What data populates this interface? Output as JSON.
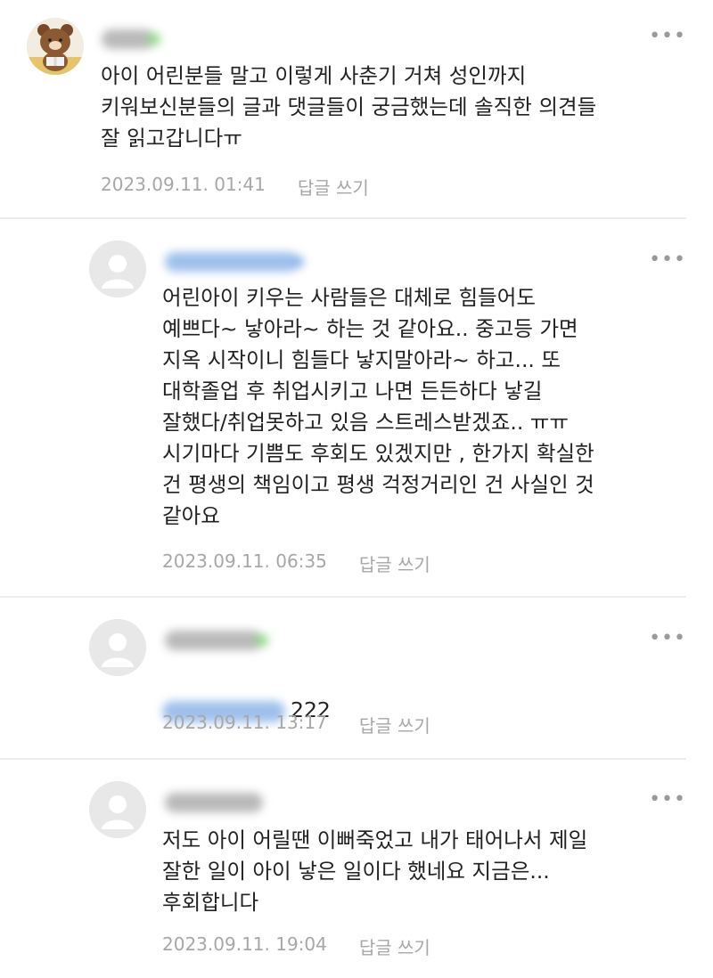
{
  "comments": [
    {
      "text": "아이 어린분들 말고 이렇게 사춘기 거쳐 성인까지\n키워보신분들의 글과 댓글들이 궁금했는데 솔직한 의견들\n잘 읽고갑니다ㅠ",
      "date": "2023.09.11. 01:41",
      "reply_label": "답글 쓰기",
      "more_icon": "more-dots-icon"
    },
    {
      "text": "어린아이 키우는 사람들은 대체로 힘들어도\n예쁘다~ 낳아라~ 하는 것 같아요.. 중고등 가면\n지옥 시작이니 힘들다 낳지말아라~ 하고... 또\n대학졸업 후 취업시키고 나면 든든하다 낳길\n잘했다/취업못하고 있음 스트레스받겠죠.. ㅠㅠ\n시기마다 기쁨도 후회도 있겠지만 , 한가지 확실한\n건 평생의 책임이고 평생 걱정거리인 건 사실인 것\n같아요",
      "date": "2023.09.11. 06:35",
      "reply_label": "답글 쓰기",
      "more_icon": "more-dots-icon"
    },
    {
      "text": "222",
      "date": "2023.09.11. 13:17",
      "reply_label": "답글 쓰기",
      "more_icon": "more-dots-icon"
    },
    {
      "text": "저도 아이 어릴땐 이뻐죽었고 내가 태어나서 제일\n잘한 일이 아이 낳은 일이다 했네요 지금은...\n후회합니다",
      "date": "2023.09.11. 19:04",
      "reply_label": "답글 쓰기",
      "more_icon": "more-dots-icon"
    }
  ]
}
